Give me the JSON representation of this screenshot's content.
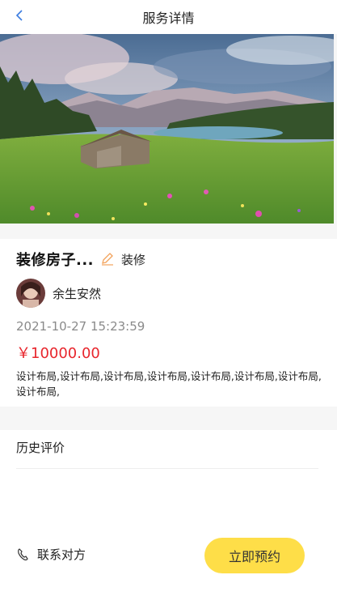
{
  "header": {
    "title": "服务详情",
    "back_icon": "chevron-left-icon"
  },
  "service": {
    "title": "装修房子...",
    "tag_icon": "pencil-icon",
    "tag": "装修",
    "user_name": "余生安然",
    "time": "2021-10-27 15:23:59",
    "price": "￥10000.00",
    "description": "设计布局,设计布局,设计布局,设计布局,设计布局,设计布局,设计布局,设计布局,"
  },
  "reviews": {
    "title": "历史评价"
  },
  "footer": {
    "contact_label": "联系对方",
    "contact_icon": "phone-icon",
    "book_label": "立即预约"
  },
  "colors": {
    "accent": "#fede48",
    "price": "#e8262d",
    "back": "#3b7ce0"
  }
}
